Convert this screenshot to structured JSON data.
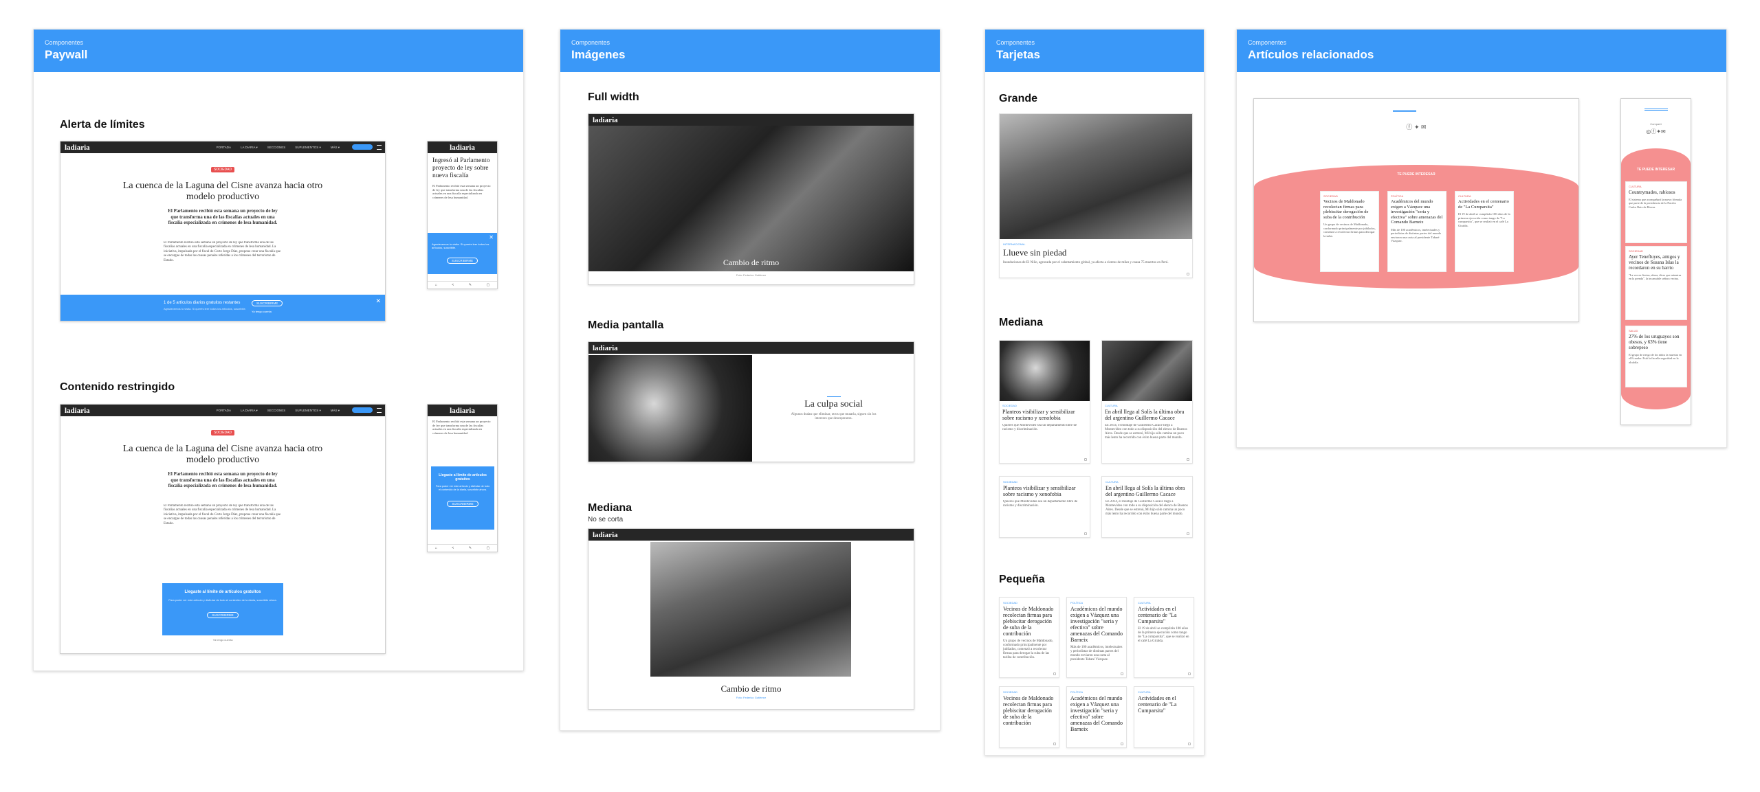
{
  "panels": {
    "paywall": {
      "kicker": "Componentes",
      "title": "Paywall"
    },
    "imagenes": {
      "kicker": "Componentes",
      "title": "Imágenes"
    },
    "tarjetas": {
      "kicker": "Componentes",
      "title": "Tarjetas"
    },
    "relacionados": {
      "kicker": "Componentes",
      "title": "Artículos relacionados"
    }
  },
  "paywall": {
    "section1": "Alerta de límites",
    "section2": "Contenido restringido",
    "brand": "ladiaria",
    "nav": [
      "PORTADA",
      "LA DIARIA ▾",
      "SECCIONES",
      "SUPLEMENTOS ▾",
      "MÁS ▾"
    ],
    "tag": "SOCIEDAD",
    "headline": "La cuenca de la Laguna del Cisne avanza hacia otro modelo productivo",
    "lead": "El Parlamento recibió esta semana un proyecto de ley que transforma una de las fiscalías actuales en una fiscalía especializada en crímenes de lesa humanidad.",
    "mobile_headline": "Ingresó al Parlamento proyecto de ley sobre nueva fiscalía",
    "mobile_text": "El Parlamento recibió esta semana un proyecto de ley que transforma una de las fiscalías actuales en una fiscalía especializada en crímenes de lesa humanidad.",
    "alert_text": "1 de 5 artículos diarios gratuitos restantes",
    "alert_small": "Agradecemos tu visita. Si querés leer todos los artículos, suscribite.",
    "alert_button": "SUSCRIBIRME",
    "alert_login": "Ya tengo cuenta",
    "close": "✕",
    "limit_title": "Llegaste al límite de artículos gratuitos",
    "limit_text": "Para poder ver este artículo y disfrutar de todo el contenido de la diaria, suscribite ahora.",
    "limit_button": "SUSCRIBIRME",
    "limit_login": "Ya tengo cuenta",
    "body": "El Parlamento recibió esta semana un proyecto de ley que transforma una de las fiscalías actuales en una fiscalía especializada en crímenes de lesa humanidad. La iniciativa, impulsada por el fiscal de Corte Jorge Díaz, propone crear una fiscalía que se encargue de todas las causas penales referidas a los crímenes del terrorismo de Estado."
  },
  "imagenes": {
    "full_label": "Full width",
    "half_label": "Media pantalla",
    "med_label": "Mediana",
    "med_sub": "No se corta",
    "brand": "ladiaria",
    "title1": "Cambio de ritmo",
    "title2": "La culpa social",
    "title3": "Cambio de ritmo",
    "caption": "Foto: Federico Gutiérrez",
    "byline": "Algunos dudan que eliminar, otros que mutarla, siguen sin los intereses que desesperaron."
  },
  "tarjetas": {
    "grande_label": "Grande",
    "mediana_label": "Mediana",
    "pequena_label": "Pequeña",
    "grande": {
      "cat": "INTERNACIONAL",
      "title": "Llueve sin piedad",
      "text": "Inundaciones de El Niño, agravada por el calentamiento global, ya afecta a cientos de miles y causa 75 muertos en Perú."
    },
    "medianas": [
      {
        "cat": "SOCIEDAD",
        "title": "Planteos visibilizar y sensibilizar sobre racismo y xenofobia",
        "text": "Quieres que Montevideo sea un departamento libre de racismo y discriminación."
      },
      {
        "cat": "CULTURA",
        "title": "En abril llega al Solís la última obra del argentino Guillermo Cacace",
        "text": "En 2014, el montaje de Guillermo Cacace llegó a Montevideo con todo a su disposición del elenco de Buenos Aires. Desde que se estrenó, Mi hijo sólo camina un poco más lento ha recorrido con éxito buena parte del mundo."
      },
      {
        "cat": "SOCIEDAD",
        "title": "Planteos visibilizar y sensibilizar sobre racismo y xenofobia",
        "text": "Quieres que Montevideo sea un departamento libre de racismo y discriminación."
      },
      {
        "cat": "CULTURA",
        "title": "En abril llega al Solís la última obra del argentino Guillermo Cacace",
        "text": "En 2014, el montaje de Guillermo Cacace llegó a Montevideo con todo a su disposición del elenco de Buenos Aires. Desde que se estrenó, Mi hijo sólo camina un poco más lento ha recorrido con éxito buena parte del mundo."
      }
    ],
    "pequenas": [
      {
        "cat": "SOCIEDAD",
        "title": "Vecinos de Maldonado recolectan firmas para plebiscitar derogación de suba de la contribución",
        "text": "Un grupo de vecinos de Maldonado, conformado principalmente por jubilados, comenzó a recolectar firmas para derogar la suba de las tarifas de contribución."
      },
      {
        "cat": "POLÍTICA",
        "title": "Académicos del mundo exigen a Vázquez una investigación \"seria y efectiva\" sobre amenazas del Comando Barneix",
        "text": "Más de 100 académicos, intelectuales y periodistas de distintas partes del mundo enviaron una carta al presidente Tabaré Vázquez."
      },
      {
        "cat": "CULTURA",
        "title": "Actividades en el centenario de \"La Cumparsita\"",
        "text": "El 19 de abril se cumplirán 100 años de la primera ejecución como tango de \"La cumparsita\", que se realizó en el café La Giralda."
      },
      {
        "cat": "SOCIEDAD",
        "title": "Vecinos de Maldonado recolectan firmas para plebiscitar derogación de suba de la contribución",
        "text": ""
      },
      {
        "cat": "POLÍTICA",
        "title": "Académicos del mundo exigen a Vázquez una investigación \"seria y efectiva\" sobre amenazas del Comando Barneix",
        "text": ""
      },
      {
        "cat": "CULTURA",
        "title": "Actividades en el centenario de \"La Cumparsita\"",
        "text": ""
      }
    ]
  },
  "relacionados": {
    "band_label": "TE PUEDE INTERESAR",
    "share_label": "Compartí",
    "desktop": [
      {
        "cat": "SOCIEDAD",
        "title": "Vecinos de Maldonado recolectan firmas para plebiscitar derogación de suba de la contribución",
        "text": "Un grupo de vecinos de Maldonado, conformado principalmente por jubilados, comenzó a recolectar firmas para derogar la suba."
      },
      {
        "cat": "POLÍTICA",
        "title": "Académicos del mundo exigen a Vázquez una investigación \"seria y efectiva\" sobre amenazas del Comando Barneix",
        "text": "Más de 100 académicos, intelectuales y periodistas de distintas partes del mundo enviaron una carta al presidente Tabaré Vázquez."
      },
      {
        "cat": "CULTURA",
        "title": "Actividades en el centenario de \"La Cumparsita\"",
        "text": "El 19 de abril se cumplirán 100 años de la primera ejecución como tango de \"La cumparsita\", que se realizó en el café La Giralda."
      }
    ],
    "mobile": [
      {
        "cat": "CULTURA",
        "title": "Countrymades, rabiosos",
        "text": "El sistema que acompañará la nueva fórmula que parte de la presidencia de la Nación Carlos Ruiz de Rivera."
      },
      {
        "cat": "SOCIEDAD",
        "title": "Ayer Tenefluyes, amigos y vecinos de Susana Islas la recordaron en su barrio",
        "text": "\"La vez en fiestas, ahora, dices que mientras en la prenda\", la incansable señora vecina."
      },
      {
        "cat": "SALUD",
        "title": "27% de los uruguayos son obesos, y 63% tiene sobrepeso",
        "text": "El grupo de riesgo de los niños la muestra en el Ecuador. Está la fiscalía seguridad en la alcaldía."
      }
    ]
  }
}
